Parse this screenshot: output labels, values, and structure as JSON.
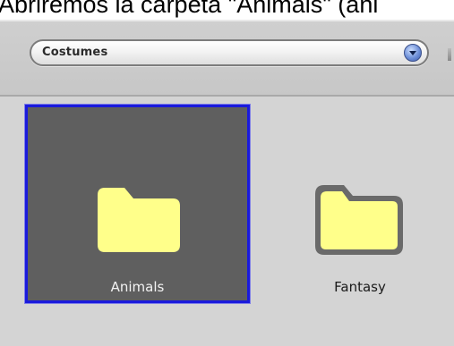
{
  "caption": "Abriremos la carpeta \"Animals\" (ani",
  "dropdown": {
    "selected": "Costumes"
  },
  "folders": [
    {
      "label": "Animals",
      "selected": true
    },
    {
      "label": "Fantasy",
      "selected": false
    }
  ],
  "colors": {
    "selection_border": "#1a1adc",
    "selection_fill": "#5f5f5f",
    "folder_fill": "#ffff8a",
    "folder_outline": "#6a6a6a"
  },
  "icons": [
    "folder-icon",
    "dropdown-arrow-icon"
  ]
}
